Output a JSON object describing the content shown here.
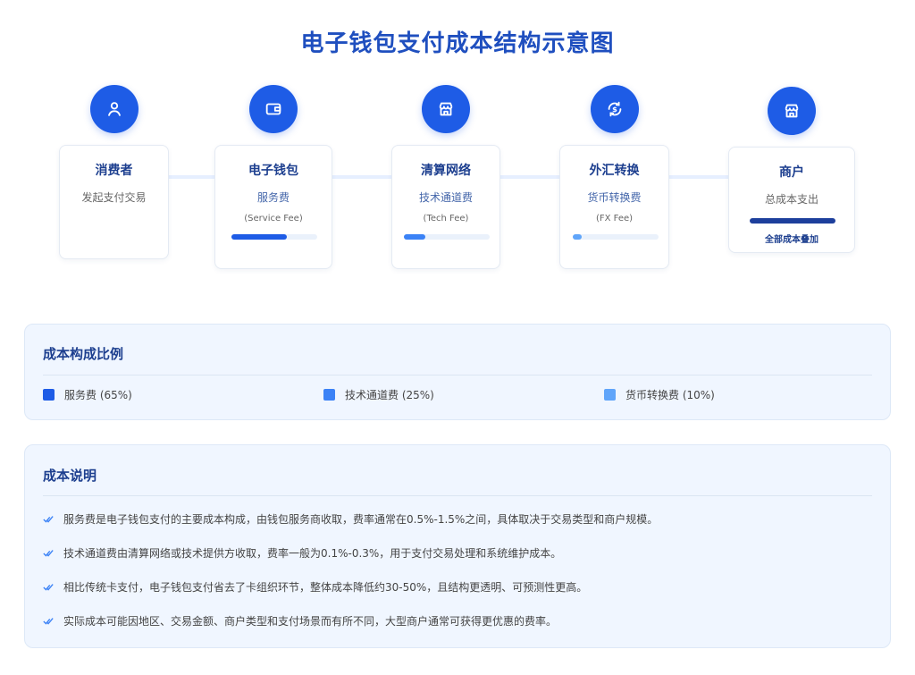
{
  "title": "电子钱包支付成本结构示意图",
  "colors": {
    "primary": "#1e5ce6",
    "service_fee": "#1e5ce6",
    "tech_fee": "#3b82f6",
    "fx_fee": "#60a5fa",
    "total": "#1d3f9c"
  },
  "flow": {
    "nodes": [
      {
        "icon": "user-icon",
        "title": "消费者",
        "subtitle": "发起支付交易"
      },
      {
        "icon": "wallet-icon",
        "title": "电子钱包",
        "subtitle": "服务费",
        "note": "(Service Fee)",
        "share": 0.65
      },
      {
        "icon": "store-icon",
        "title": "清算网络",
        "subtitle": "技术通道费",
        "note": "(Tech Fee)",
        "share": 0.25
      },
      {
        "icon": "currency-exchange-icon",
        "title": "外汇转换",
        "subtitle": "货币转换费",
        "note": "(FX Fee)",
        "share": 0.1
      },
      {
        "icon": "shop-icon",
        "title": "商户",
        "subtitle": "总成本支出",
        "note": "全部成本叠加"
      }
    ]
  },
  "composition": {
    "title": "成本构成比例",
    "legend": [
      {
        "label": "服务费 (65%)",
        "color": "#1e5ce6"
      },
      {
        "label": "技术通道费 (25%)",
        "color": "#3b82f6"
      },
      {
        "label": "货币转换费 (10%)",
        "color": "#60a5fa"
      }
    ]
  },
  "explanation": {
    "title": "成本说明",
    "items": [
      "服务费是电子钱包支付的主要成本构成，由钱包服务商收取，费率通常在0.5%-1.5%之间，具体取决于交易类型和商户规模。",
      "技术通道费由清算网络或技术提供方收取，费率一般为0.1%-0.3%，用于支付交易处理和系统维护成本。",
      "相比传统卡支付，电子钱包支付省去了卡组织环节，整体成本降低约30-50%，且结构更透明、可预测性更高。",
      "实际成本可能因地区、交易金额、商户类型和支付场景而有所不同，大型商户通常可获得更优惠的费率。"
    ]
  }
}
